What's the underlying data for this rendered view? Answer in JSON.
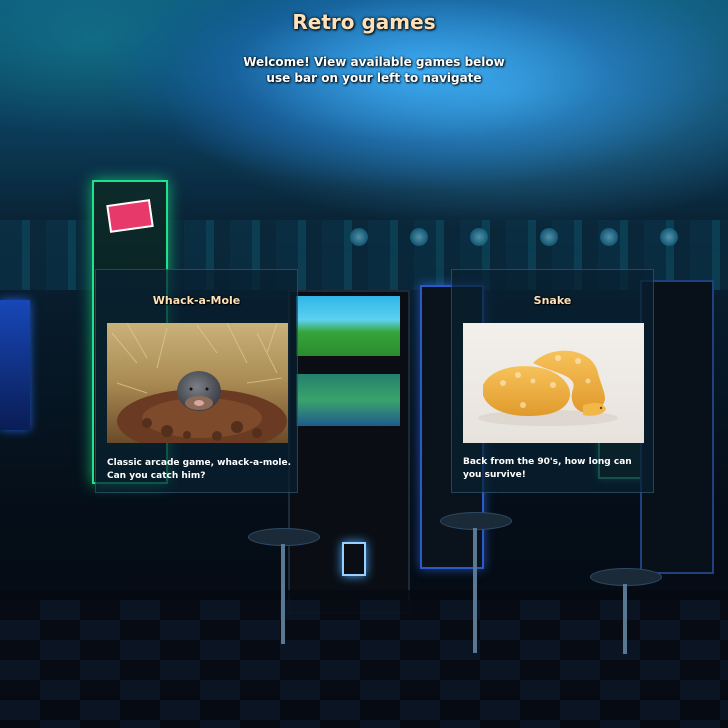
{
  "page": {
    "title": "Retro games",
    "subtitle_line1": "Welcome! View available games below",
    "subtitle_line2": "use bar on your left to navigate"
  },
  "games": [
    {
      "title": "Whack-a-Mole",
      "image": "mole-photo",
      "description": "Classic arcade game, whack-a-mole. Can you catch him?"
    },
    {
      "title": "Snake",
      "image": "snake-photo",
      "description": "Back from the 90's, how long can you survive!"
    }
  ],
  "colors": {
    "title": "#ffe1b8",
    "card_background": "#082030",
    "text": "#ffffff"
  }
}
